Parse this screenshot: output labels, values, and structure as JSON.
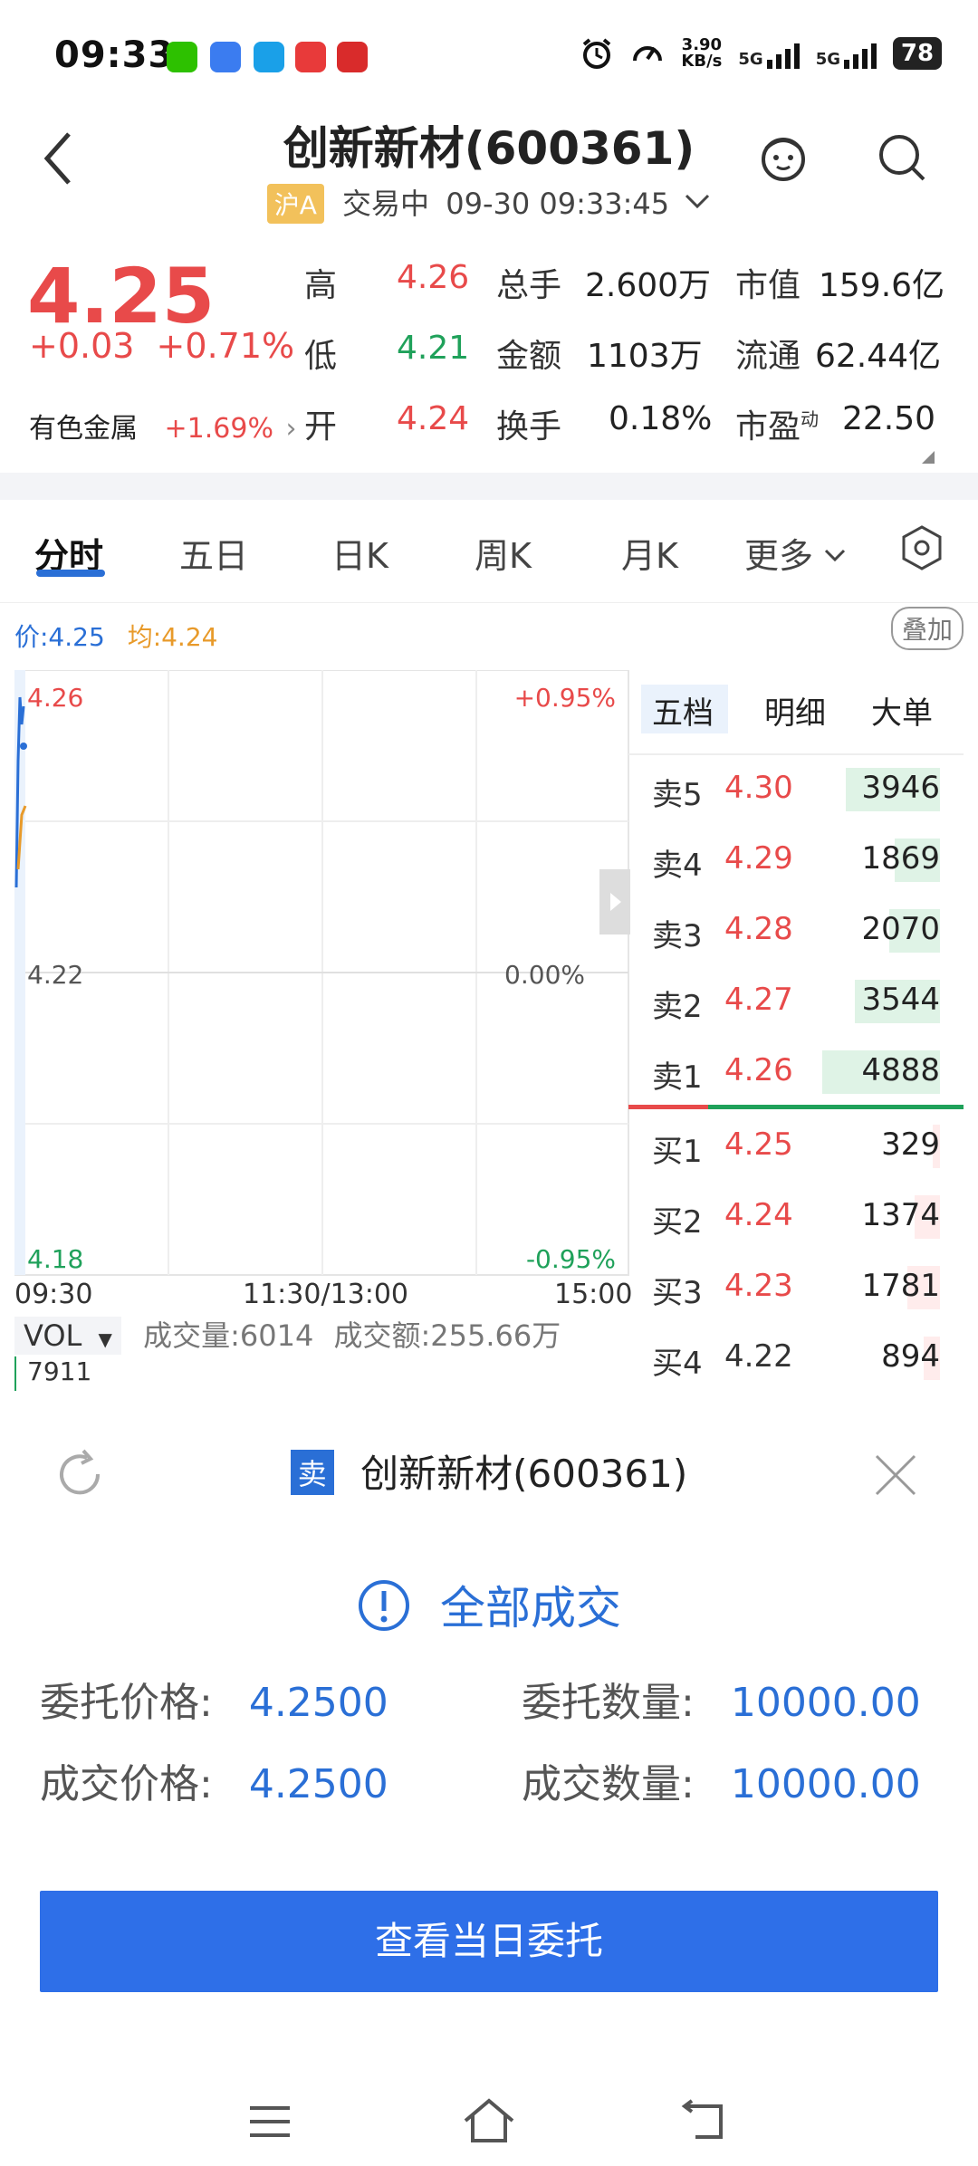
{
  "status_bar": {
    "time": "09:33",
    "net_speed": "3.90",
    "net_unit": "KB/s",
    "sim1": "5G",
    "sim2": "5G",
    "battery": "78"
  },
  "header": {
    "title": "创新新材(600361)",
    "market_tag": "沪A",
    "status": "交易中",
    "datetime": "09-30 09:33:45"
  },
  "quote": {
    "price": "4.25",
    "change": "+0.03",
    "change_pct": "+0.71%",
    "sector": "有色金属",
    "sector_change": "+1.69%",
    "high_label": "高",
    "high": "4.26",
    "low_label": "低",
    "low": "4.21",
    "open_label": "开",
    "open": "4.24",
    "volume_label": "总手",
    "volume": "2.600万",
    "amount_label": "金额",
    "amount": "1103万",
    "turnover_label": "换手",
    "turnover": "0.18%",
    "mktcap_label": "市值",
    "mktcap": "159.6亿",
    "float_label": "流通",
    "float": "62.44亿",
    "pe_label": "市盈",
    "pe_sup": "动",
    "pe": "22.50"
  },
  "tabs": [
    "分时",
    "五日",
    "日K",
    "周K",
    "月K",
    "更多"
  ],
  "chart": {
    "price_label": "价:4.25",
    "avg_label": "均:4.24",
    "overlay": "叠加",
    "y_top": "4.26",
    "y_mid": "4.22",
    "y_bot": "4.18",
    "pct_top": "+0.95%",
    "pct_mid": "0.00%",
    "pct_bot": "-0.95%",
    "x_start": "09:30",
    "x_mid": "11:30/13:00",
    "x_end": "15:00",
    "vol_selector": "VOL",
    "vol_text": "成交量:6014",
    "amount_text": "成交额:255.66万",
    "vol_axis": "7911",
    "colors": {
      "price_line": "#2a6fd6",
      "avg_line": "#e89a2a",
      "up": "#e84a4a",
      "down": "#1fa15a"
    }
  },
  "orderbook": {
    "tabs": [
      "五档",
      "明细",
      "大单"
    ],
    "sells": [
      {
        "label": "卖5",
        "price": "4.30",
        "vol": "3946"
      },
      {
        "label": "卖4",
        "price": "4.29",
        "vol": "1869"
      },
      {
        "label": "卖3",
        "price": "4.28",
        "vol": "2070"
      },
      {
        "label": "卖2",
        "price": "4.27",
        "vol": "3544"
      },
      {
        "label": "卖1",
        "price": "4.26",
        "vol": "4888"
      }
    ],
    "buys": [
      {
        "label": "买1",
        "price": "4.25",
        "vol": "329"
      },
      {
        "label": "买2",
        "price": "4.24",
        "vol": "1374"
      },
      {
        "label": "买3",
        "price": "4.23",
        "vol": "1781"
      },
      {
        "label": "买4",
        "price": "4.22",
        "vol": "894"
      }
    ]
  },
  "dialog": {
    "badge": "卖",
    "title": "创新新材(600361)",
    "result": "全部成交",
    "order_price_label": "委托价格:",
    "order_price": "4.2500",
    "order_qty_label": "委托数量:",
    "order_qty": "10000.00",
    "deal_price_label": "成交价格:",
    "deal_price": "4.2500",
    "deal_qty_label": "成交数量:",
    "deal_qty": "10000.00",
    "button": "查看当日委托"
  }
}
